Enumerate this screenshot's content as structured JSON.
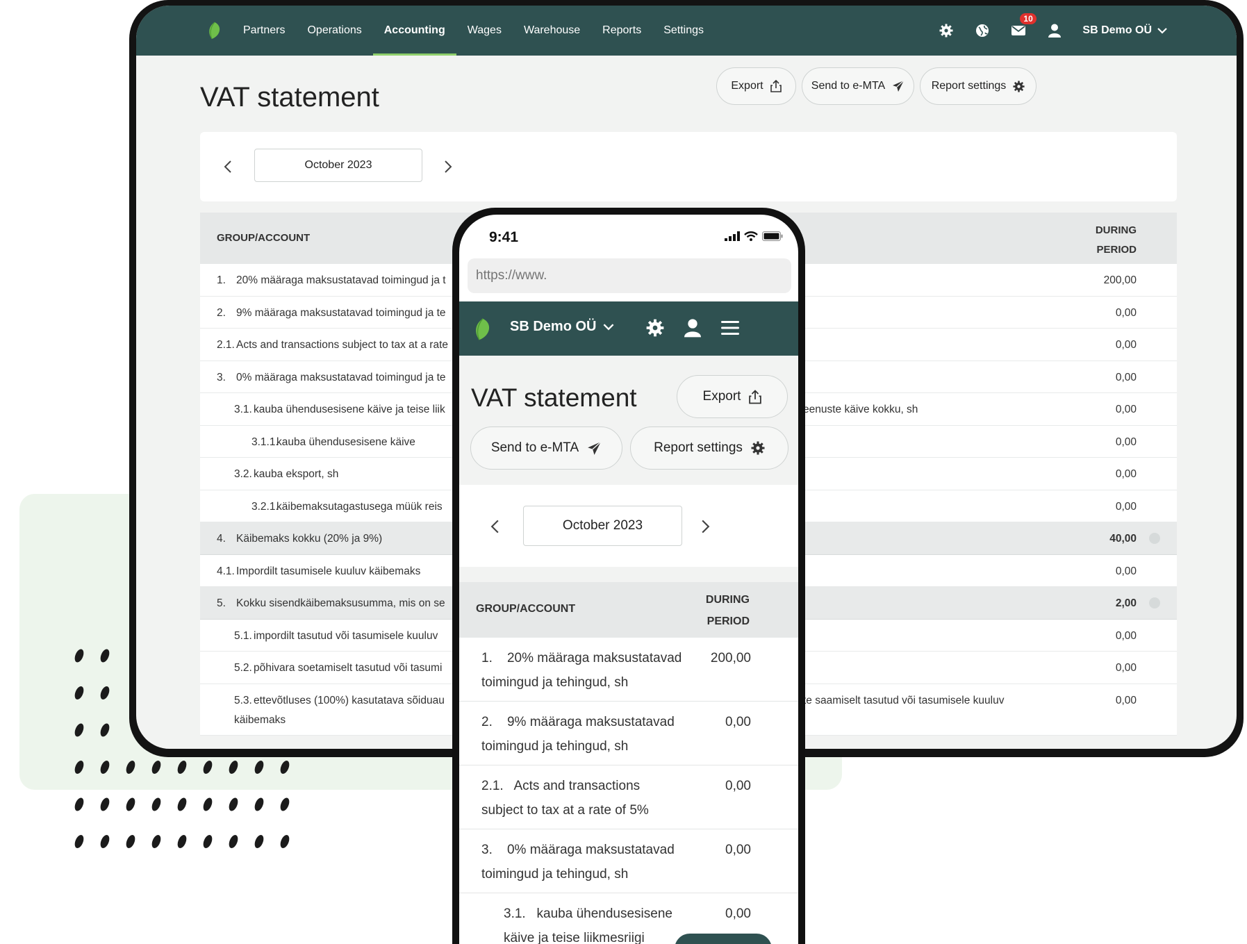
{
  "desktop": {
    "nav": {
      "items": [
        "Partners",
        "Operations",
        "Accounting",
        "Wages",
        "Warehouse",
        "Reports",
        "Settings"
      ],
      "active": "Accounting",
      "mail_badge": "10",
      "company": "SB Demo OÜ"
    },
    "title": "VAT statement",
    "buttons": {
      "export": "Export",
      "send": "Send to e-MTA",
      "settings": "Report settings"
    },
    "period": "October 2023",
    "table": {
      "col_left": "GROUP/ACCOUNT",
      "col_right_1": "DURING",
      "col_right_2": "PERIOD",
      "rows": [
        {
          "num": "1.",
          "label": "20% määraga maksustatavad toimingud ja t",
          "right": "",
          "value": "200,00"
        },
        {
          "num": "2.",
          "label": "9% määraga maksustatavad toimingud ja te",
          "right": "",
          "value": "0,00"
        },
        {
          "num": "2.1.",
          "label": "Acts and transactions subject to tax at a rate",
          "right": "",
          "value": "0,00"
        },
        {
          "num": "3.",
          "label": "0% määraga maksustatavad toimingud ja te",
          "right": "",
          "value": "0,00"
        },
        {
          "num": "3.1.",
          "label": "kauba ühendusesisene käive ja teise liik",
          "right": "eenuste käive kokku, sh",
          "value": "0,00"
        },
        {
          "num": "3.1.1.",
          "label": "kauba ühendusesisene käive",
          "right": "",
          "value": "0,00"
        },
        {
          "num": "3.2.",
          "label": "kauba eksport, sh",
          "right": "",
          "value": "0,00"
        },
        {
          "num": "3.2.1.",
          "label": "käibemaksutagastusega müük reis",
          "right": "",
          "value": "0,00"
        },
        {
          "num": "4.",
          "label": "Käibemaks kokku (20% ja 9%)",
          "right": "",
          "value": "40,00"
        },
        {
          "num": "4.1.",
          "label": "Impordilt tasumisele kuuluv käibemaks",
          "right": "",
          "value": "0,00"
        },
        {
          "num": "5.",
          "label": "Kokku sisendkäibemaksusumma, mis on se",
          "right": "",
          "value": "2,00"
        },
        {
          "num": "5.1.",
          "label": "impordilt tasutud või tasumisele kuuluv",
          "right": "",
          "value": "0,00"
        },
        {
          "num": "5.2.",
          "label": "põhivara soetamiselt tasutud või tasumi",
          "right": "",
          "value": "0,00"
        },
        {
          "num": "5.3.",
          "label": "ettevõtluses (100%) kasutatava sõiduau",
          "label2": "käibemaks",
          "right": "te saamiselt tasutud või tasumisele kuuluv",
          "value": "0,00"
        }
      ]
    }
  },
  "mobile": {
    "status_time": "9:41",
    "url_placeholder": "https://www.",
    "company": "SB Demo OÜ",
    "title": "VAT statement",
    "buttons": {
      "export": "Export",
      "send": "Send to e-MTA",
      "settings": "Report settings"
    },
    "period": "October 2023",
    "table": {
      "col_left": "GROUP/ACCOUNT",
      "col_right_1": "DURING",
      "col_right_2": "PERIOD",
      "rows": [
        {
          "label": "1.    20% määraga maksustatavad toimingud ja tehingud, sh",
          "value": "200,00"
        },
        {
          "label": "2.    9% määraga maksustatavad toimingud ja tehingud, sh",
          "value": "0,00"
        },
        {
          "label": "2.1.   Acts and transactions subject to tax at a rate of 5%",
          "value": "0,00"
        },
        {
          "label": "3.    0% määraga maksustatavad toimingud ja tehingud, sh",
          "value": "0,00"
        },
        {
          "label": "3.1.   kauba ühendusesisene käive ja teise liikmesriigi",
          "value": "0,00"
        }
      ]
    }
  },
  "colors": {
    "nav": "#2f5151",
    "accent": "#8fcf6b",
    "badge": "#e0312d",
    "panel": "#edf5ec"
  }
}
